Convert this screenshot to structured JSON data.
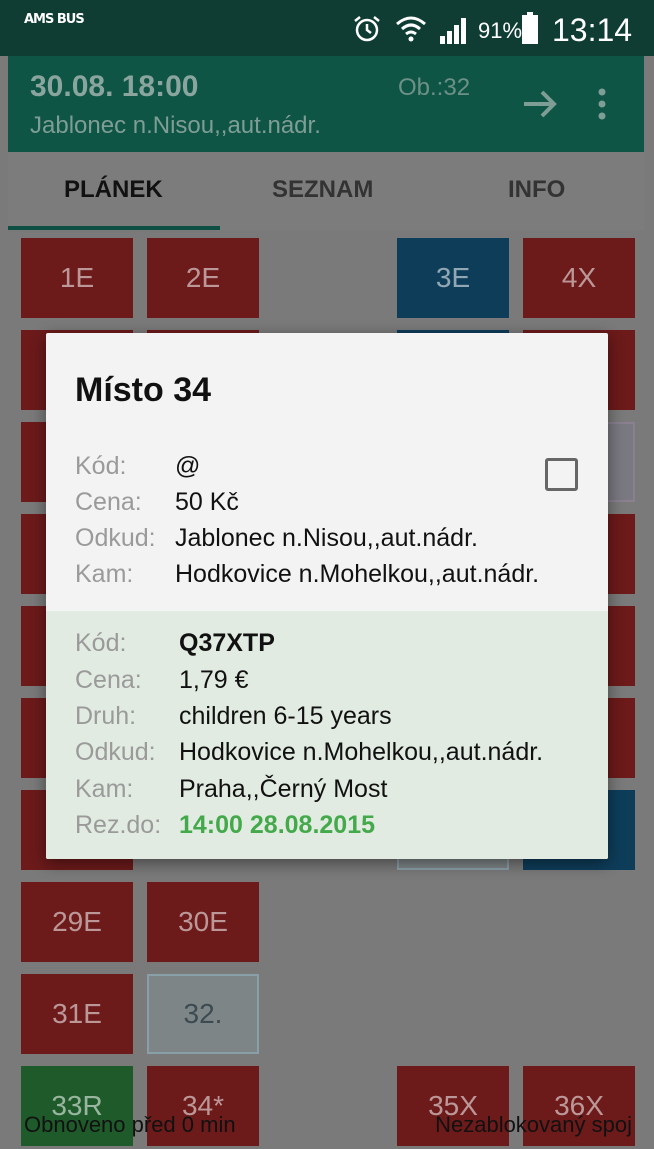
{
  "status_bar": {
    "logo": "AMS BUS",
    "battery_percent": "91%",
    "time": "13:14",
    "icons": [
      "alarm-icon",
      "wifi-icon",
      "signal-icon",
      "battery-icon"
    ]
  },
  "action_bar": {
    "datetime": "30.08. 18:00",
    "ob": "Ob.:32",
    "station": "Jablonec n.Nisou,,aut.nádr."
  },
  "tabs": [
    {
      "label": "PLÁNEK",
      "active": true
    },
    {
      "label": "SEZNAM",
      "active": false
    },
    {
      "label": "INFO",
      "active": false
    }
  ],
  "seats": [
    {
      "label": "1E",
      "state": "red"
    },
    {
      "label": "2E",
      "state": "red"
    },
    {
      "label": "3E",
      "state": "blue"
    },
    {
      "label": "4X",
      "state": "red"
    },
    {
      "label": "29E",
      "state": "red"
    },
    {
      "label": "30E",
      "state": "red"
    },
    {
      "label": "31E",
      "state": "red"
    },
    {
      "label": "32.",
      "state": "free"
    },
    {
      "label": "33R",
      "state": "green"
    },
    {
      "label": "34*",
      "state": "red"
    },
    {
      "label": "35X",
      "state": "red"
    },
    {
      "label": "36X",
      "state": "red"
    }
  ],
  "bottom": {
    "left": "Obnoveno před 0 min",
    "right": "Nezablokovaný spoj"
  },
  "dialog": {
    "title": "Místo 34",
    "section1": {
      "kod_label": "Kód:",
      "kod": "@",
      "cena_label": "Cena:",
      "cena": "50 Kč",
      "odkud_label": "Odkud:",
      "odkud": "Jablonec n.Nisou,,aut.nádr.",
      "kam_label": "Kam:",
      "kam": "Hodkovice n.Mohelkou,,aut.nádr."
    },
    "section2": {
      "kod_label": "Kód:",
      "kod": "Q37XTP",
      "cena_label": "Cena:",
      "cena": "1,79 €",
      "druh_label": "Druh:",
      "druh": "children 6-15 years",
      "odkud_label": "Odkud:",
      "odkud": "Hodkovice n.Mohelkou,,aut.nádr.",
      "kam_label": "Kam:",
      "kam": "Praha,,Černý Most",
      "rez_label": "Rez.do:",
      "rez": "14:00 28.08.2015"
    },
    "colors": {
      "reservation": "#43a94a",
      "section2_bg": "#e1ebe1"
    }
  }
}
